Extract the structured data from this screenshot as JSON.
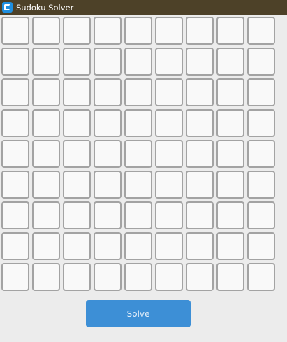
{
  "window": {
    "title": "Sudoku Solver",
    "icon": "app-icon"
  },
  "board": {
    "rows": 9,
    "cols": 9,
    "cells": [
      [
        "",
        "",
        "",
        "",
        "",
        "",
        "",
        "",
        ""
      ],
      [
        "",
        "",
        "",
        "",
        "",
        "",
        "",
        "",
        ""
      ],
      [
        "",
        "",
        "",
        "",
        "",
        "",
        "",
        "",
        ""
      ],
      [
        "",
        "",
        "",
        "",
        "",
        "",
        "",
        "",
        ""
      ],
      [
        "",
        "",
        "",
        "",
        "",
        "",
        "",
        "",
        ""
      ],
      [
        "",
        "",
        "",
        "",
        "",
        "",
        "",
        "",
        ""
      ],
      [
        "",
        "",
        "",
        "",
        "",
        "",
        "",
        "",
        ""
      ],
      [
        "",
        "",
        "",
        "",
        "",
        "",
        "",
        "",
        ""
      ],
      [
        "",
        "",
        "",
        "",
        "",
        "",
        "",
        "",
        ""
      ]
    ]
  },
  "actions": {
    "solve_label": "Solve"
  },
  "colors": {
    "titlebar": "#4d4128",
    "background": "#ececec",
    "cell_border": "#a3a3a3",
    "cell_fill": "#f9f9f9",
    "accent": "#3d8fd6"
  }
}
